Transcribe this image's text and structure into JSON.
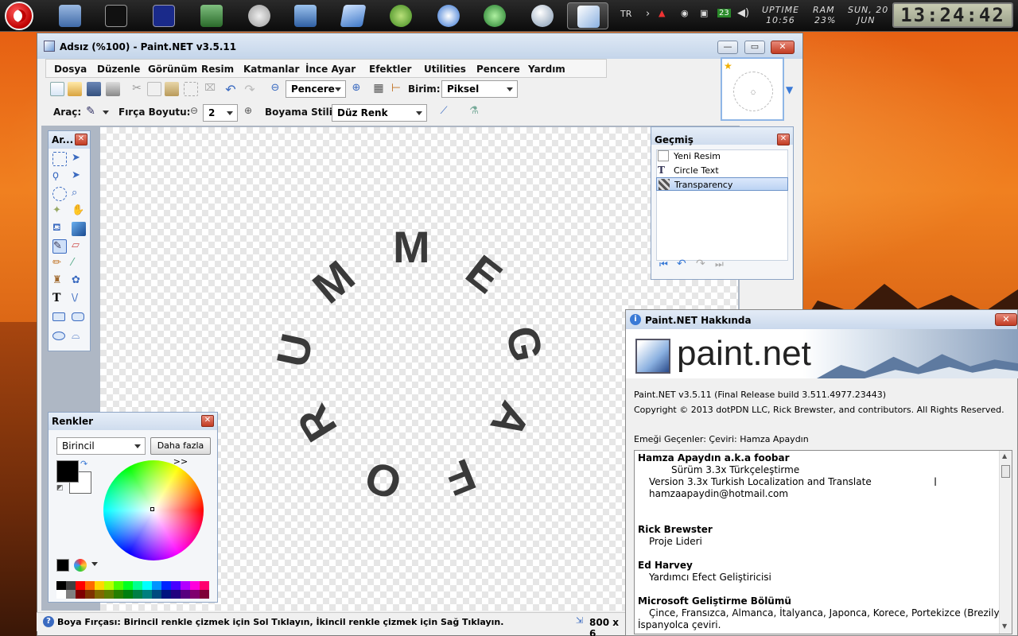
{
  "taskbar": {
    "lang": "TR",
    "uptime_label": "UPTIME",
    "uptime_value": "10:56",
    "ram_label": "RAM",
    "ram_value": "23%",
    "date_line1": "SUN, 20",
    "date_line2": "JUN",
    "tray_badge": "23",
    "clock": "13:24:42"
  },
  "main_window": {
    "title": "Adsız (%100) - Paint.NET v3.5.11",
    "menu": [
      "Dosya",
      "Düzenle",
      "Görünüm",
      "Resim",
      "Katmanlar",
      "İnce Ayar",
      "Efektler",
      "Utilities",
      "Pencere",
      "Yardım"
    ],
    "toolbar1": {
      "zoom_value": "Pencere",
      "units_label": "Birim:",
      "units_value": "Piksel"
    },
    "toolbar2": {
      "tool_label": "Araç:",
      "brush_label": "Fırça Boyutu:",
      "brush_value": "2",
      "style_label": "Boyama Stili:",
      "style_value": "Düz Renk"
    }
  },
  "canvas_text": {
    "letters": [
      "U",
      "M",
      "M",
      "E",
      "G",
      "A",
      "F",
      "O",
      "R",
      "U"
    ]
  },
  "tools_panel": {
    "title": "Ar..."
  },
  "history_panel": {
    "title": "Geçmiş",
    "items": [
      "Yeni Resim",
      "Circle Text",
      "Transparency"
    ]
  },
  "colors_panel": {
    "title": "Renkler",
    "mode": "Birincil",
    "more_button": "Daha fazla >>",
    "palette": [
      "#000000",
      "#404040",
      "#ff0000",
      "#ff6a00",
      "#ffd800",
      "#b6ff00",
      "#4cff00",
      "#00ff21",
      "#00ff90",
      "#00ffff",
      "#0094ff",
      "#0026ff",
      "#4800ff",
      "#b200ff",
      "#ff00dc",
      "#ff006e",
      "#ffffff",
      "#808080",
      "#7f0000",
      "#7f3300",
      "#7f6a00",
      "#5b7f00",
      "#267f00",
      "#007f0e",
      "#007f46",
      "#007f7f",
      "#004a7f",
      "#00137f",
      "#21007f",
      "#57007f",
      "#7f006e",
      "#7f0037"
    ]
  },
  "status_bar": {
    "text": "Boya Fırçası: Birincil renkle çizmek için Sol Tıklayın, İkincil renkle çizmek için Sağ Tıklayın.",
    "size": "800 x 6"
  },
  "about_dialog": {
    "title": "Paint.NET Hakkında",
    "logo_text": "paint.net",
    "version": "Paint.NET v3.5.11 (Final Release build 3.511.4977.23443)",
    "copyright": "Copyright © 2013 dotPDN LLC, Rick Brewster, and contributors. All Rights Reserved.",
    "credits_label": "Emeği Geçenler: Çeviri: Hamza Apaydın",
    "credits": [
      {
        "bold": true,
        "text": "Hamza Apaydın a.k.a foobar",
        "indent": false
      },
      {
        "bold": false,
        "text": "Sürüm 3.3x Türkçeleştirme",
        "indent": true
      },
      {
        "bold": false,
        "text": "Version 3.3x Turkish Localization and Translate",
        "indent": true
      },
      {
        "bold": false,
        "text": "hamzaapaydin@hotmail.com",
        "indent": true
      },
      {
        "bold": true,
        "text": "Rick Brewster",
        "indent": false
      },
      {
        "bold": false,
        "text": "Proje Lideri",
        "indent": true
      },
      {
        "bold": true,
        "text": "Ed Harvey",
        "indent": false
      },
      {
        "bold": false,
        "text": "Yardımcı Efect Geliştiricisi",
        "indent": true
      },
      {
        "bold": true,
        "text": "Microsoft Geliştirme Bölümü",
        "indent": false
      },
      {
        "bold": false,
        "text": "Çince, Fransızca, Almanca, İtalyanca, Japonca, Korece, Portekizce (Brezilya) ve",
        "indent": true
      },
      {
        "bold": false,
        "text": "İspanyolca çeviri.",
        "indent": false
      }
    ]
  }
}
